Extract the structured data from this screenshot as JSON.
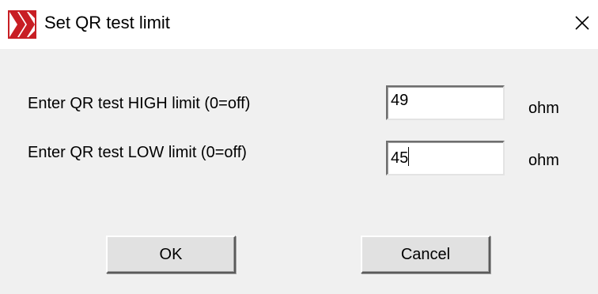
{
  "window": {
    "title": "Set QR test limit",
    "icon": "k-logo-icon",
    "close_icon": "close-icon"
  },
  "form": {
    "high": {
      "label": "Enter QR test HIGH limit  (0=off)",
      "value": "49",
      "unit": "ohm"
    },
    "low": {
      "label": "Enter QR test LOW limit  (0=off)",
      "value": "45",
      "unit": "ohm"
    }
  },
  "buttons": {
    "ok_label": "OK",
    "cancel_label": "Cancel"
  },
  "colors": {
    "logo_red": "#c81e24",
    "titlebar": "#ffffff",
    "dialog_bg": "#f0f0f0"
  }
}
